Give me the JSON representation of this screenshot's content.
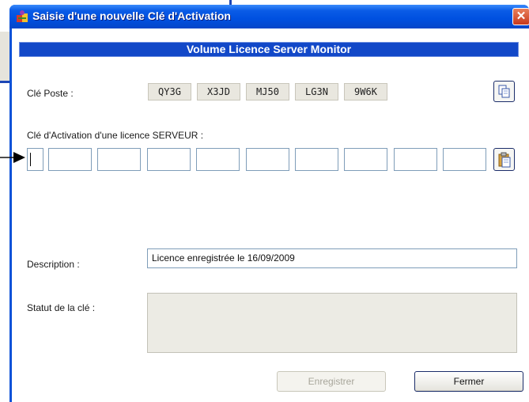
{
  "window": {
    "title": "Saisie d'une nouvelle Clé d'Activation",
    "close_label": "✕"
  },
  "banner": "Volume Licence Server Monitor",
  "poste": {
    "label": "Clé Poste :",
    "segments": [
      "QY3G",
      "X3JD",
      "MJ50",
      "LG3N",
      "9W6K"
    ]
  },
  "activation": {
    "label": "Clé d'Activation d'une licence SERVEUR :",
    "field_count": 10
  },
  "description": {
    "label": "Description :",
    "value": "Licence enregistrée le 16/09/2009"
  },
  "statut": {
    "label": "Statut de la clé :"
  },
  "buttons": {
    "save": "Enregistrer",
    "close": "Fermer"
  },
  "icons": {
    "copy": "copy-icon",
    "paste": "paste-icon",
    "app": "app-icon",
    "pointer": "arrow-pointer-icon"
  },
  "colors": {
    "titlebar": "#0050e0",
    "banner": "#1248c8",
    "close_button": "#c8391d"
  }
}
